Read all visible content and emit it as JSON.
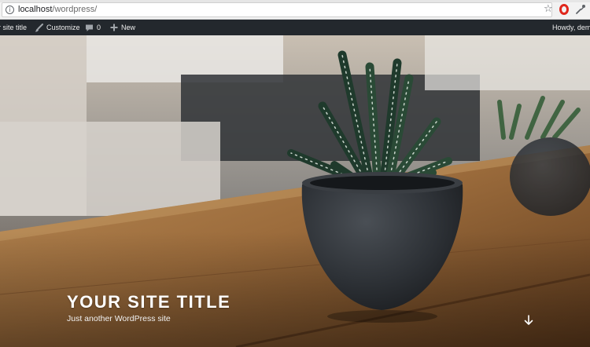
{
  "browser": {
    "url_host": "localhost",
    "url_path": "/wordpress/",
    "icons": [
      "info-icon",
      "star-icon",
      "opera-icon",
      "eyedropper-icon"
    ]
  },
  "admin_bar": {
    "site_title": "r site title",
    "customize": "Customize",
    "comments_count": "0",
    "new": "New",
    "howdy": "Howdy, demr",
    "background": "#23282d"
  },
  "hero": {
    "title": "YOUR SITE TITLE",
    "tagline": "Just another WordPress site",
    "scroll_icon": "arrow-down-icon"
  }
}
